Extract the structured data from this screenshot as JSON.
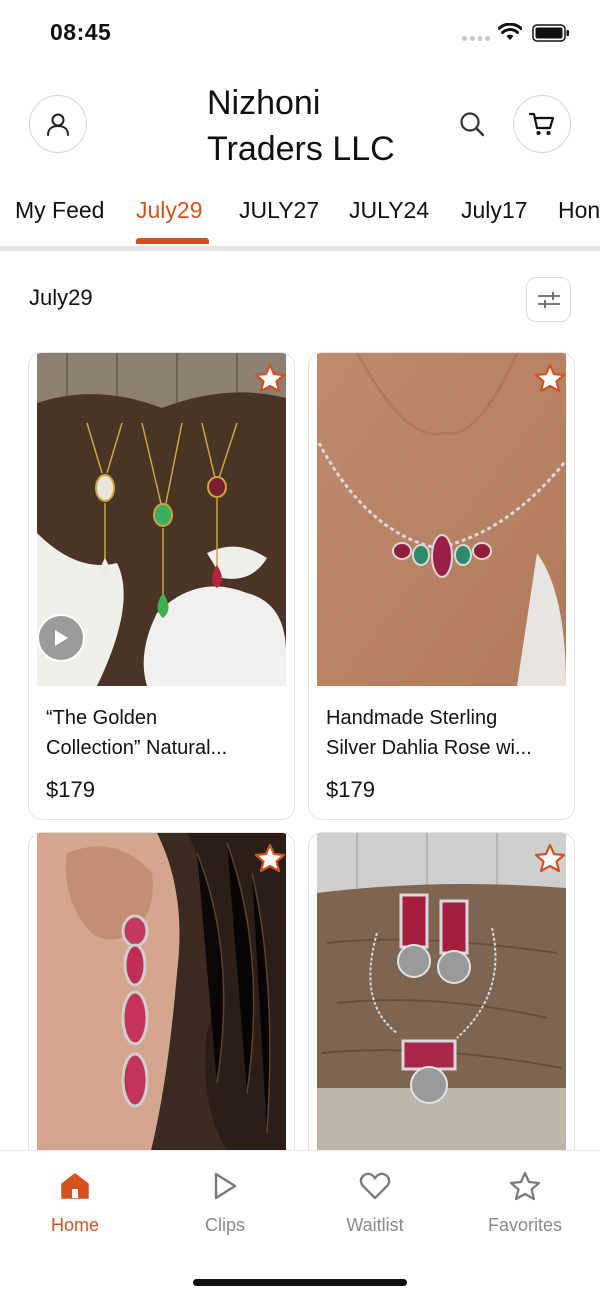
{
  "status_bar": {
    "time": "08:45"
  },
  "header": {
    "title_line1": "Nizhoni",
    "title_line2": "Traders LLC"
  },
  "tabs": [
    {
      "label": "My Feed",
      "active": false
    },
    {
      "label": "July29",
      "active": true
    },
    {
      "label": "JULY27",
      "active": false
    },
    {
      "label": "JULY24",
      "active": false
    },
    {
      "label": "July17",
      "active": false
    },
    {
      "label": "Hon",
      "active": false
    }
  ],
  "section": {
    "title": "July29"
  },
  "products": [
    {
      "title_line1": "“The Golden",
      "title_line2": "Collection” Natural...",
      "price": "$179",
      "has_video": true
    },
    {
      "title_line1": "Handmade Sterling",
      "title_line2": "Silver Dahlia Rose wi...",
      "price": "$179",
      "has_video": false
    },
    {
      "title_line1": "",
      "title_line2": "",
      "price": "",
      "has_video": false
    },
    {
      "title_line1": "",
      "title_line2": "",
      "price": "",
      "has_video": false
    }
  ],
  "bottom_nav": [
    {
      "label": "Home",
      "icon": "home-icon",
      "active": true
    },
    {
      "label": "Clips",
      "icon": "play-icon",
      "active": false
    },
    {
      "label": "Waitlist",
      "icon": "heart-icon",
      "active": false
    },
    {
      "label": "Favorites",
      "icon": "star-icon",
      "active": false
    }
  ],
  "colors": {
    "accent": "#d2531f",
    "muted": "#8a8a8a",
    "border": "#e2e2e2"
  }
}
